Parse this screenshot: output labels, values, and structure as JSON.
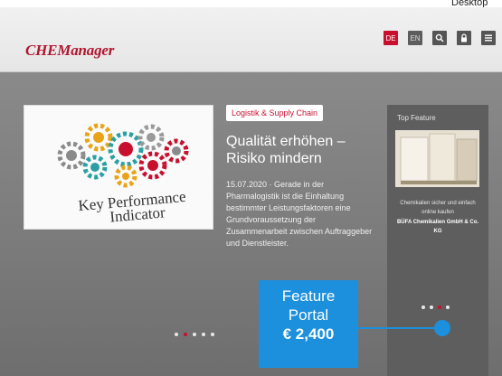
{
  "os": {
    "desktop_label": "Desktop"
  },
  "header": {
    "logo": "CHEManager",
    "lang_de": "DE",
    "lang_en": "EN",
    "icons": [
      "search-icon",
      "lock-icon",
      "menu-icon"
    ]
  },
  "slide": {
    "image_text_line1": "Key Performance",
    "image_text_line2": "Indicator",
    "category": "Logistik & Supply Chain",
    "title": "Qualität erhöhen – Risiko mindern",
    "body": "15.07.2020 · Gerade in der Pharmalogistik ist die Einhaltung bestimmter Leistungsfaktoren eine Grundvoraussetzung der Zusammenarbeit zwischen Auftraggeber und Dienstleister.",
    "dots_count": 5,
    "active_dot": 1
  },
  "sidebar": {
    "heading": "Top Feature",
    "caption": "Chemikalien sicher und einfach online kaufen",
    "company": "BÜFA Chemikalien GmbH & Co. KG",
    "dots_count": 4,
    "active_dot": 2
  },
  "feature": {
    "line1": "Feature",
    "line2": "Portal",
    "price": "€ 2,400"
  },
  "colors": {
    "brand_red": "#c8102e",
    "callout_blue": "#1c8fdd",
    "page_gray": "#7a7a7a"
  }
}
